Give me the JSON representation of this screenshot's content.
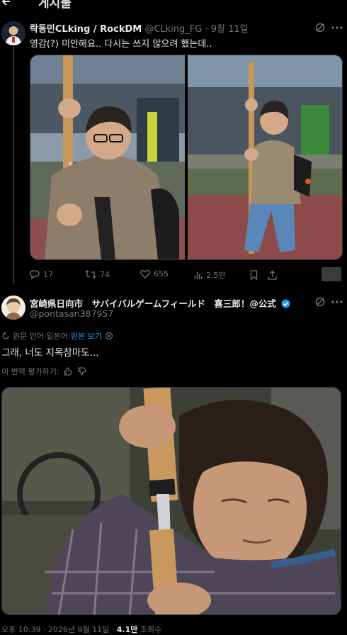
{
  "header": {
    "title": "게시물",
    "back_icon": "arrow-left-icon"
  },
  "tweet1": {
    "author_name": "락동민CLking / RockDM",
    "handle": "@CLking_FG",
    "date": "9월 11일",
    "text": "영감(?) 미안해요.. 다시는 쓰지 않으려 했는데..",
    "actions": {
      "replies": "17",
      "retweets": "74",
      "likes": "655",
      "views": "2.5만"
    }
  },
  "tweet2": {
    "author_name": "宮崎県日向市　サバイバルゲームフィールド　喜三郎！@公式",
    "handle": "@pontasan387957",
    "translate_note": "원문 언어 일본어",
    "show_original": "원본 보기",
    "text": "그래, 너도 지옥참마도...",
    "rate_translation": "이 번역 평가하기:",
    "timestamp": "오후 10:39 · 2026년 9월 11일 ·",
    "views_count": "4.1만",
    "views_label": "조회수"
  },
  "colors": {
    "background": "#000000",
    "text": "#e7e9ea",
    "muted": "#71767b",
    "link": "#1d9bf0",
    "verified": "#1d9bf0"
  }
}
